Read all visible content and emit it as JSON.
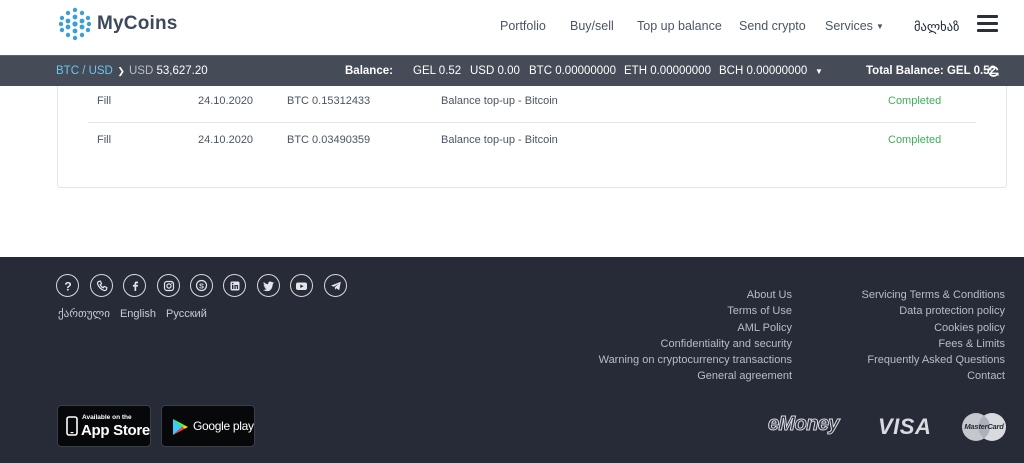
{
  "header": {
    "logo_text": "MyCoins",
    "nav": {
      "portfolio": "Portfolio",
      "buy_sell": "Buy/sell",
      "top_up": "Top up balance",
      "send_crypto": "Send crypto",
      "services": "Services"
    },
    "language_label": "მალხაზ"
  },
  "ticker": {
    "pair": "BTC / USD",
    "rate_currency": "USD",
    "rate_value": "53,627.20",
    "balance_label": "Balance:",
    "balances": [
      {
        "currency": "GEL",
        "value": "0.52"
      },
      {
        "currency": "USD",
        "value": "0.00"
      },
      {
        "currency": "BTC",
        "value": "0.00000000"
      },
      {
        "currency": "ETH",
        "value": "0.00000000"
      },
      {
        "currency": "BCH",
        "value": "0.00000000"
      }
    ],
    "total_label": "Total Balance:",
    "total_value": "GEL 0.52"
  },
  "transactions": [
    {
      "type": "Fill",
      "date": "24.10.2020",
      "amount": "BTC 0.15312433",
      "description": "Balance top-up - Bitcoin",
      "status": "Completed"
    },
    {
      "type": "Fill",
      "date": "24.10.2020",
      "amount": "BTC 0.03490359",
      "description": "Balance top-up - Bitcoin",
      "status": "Completed"
    }
  ],
  "footer": {
    "social_icons": [
      "help-icon",
      "phone-icon",
      "facebook-icon",
      "instagram-icon",
      "skype-icon",
      "linkedin-icon",
      "twitter-icon",
      "youtube-icon",
      "telegram-icon"
    ],
    "languages": [
      "ქართული",
      "English",
      "Русский"
    ],
    "links_left": [
      "About Us",
      "Terms of Use",
      "AML Policy",
      "Confidentiality and security",
      "Warning on cryptocurrency transactions",
      "General agreement"
    ],
    "links_right": [
      "Servicing Terms & Conditions",
      "Data protection policy",
      "Cookies policy",
      "Fees & Limits",
      "Frequently Asked Questions",
      "Contact"
    ],
    "app_store": {
      "small": "Available on the",
      "big": "App Store"
    },
    "google_play": {
      "big": "Google play"
    },
    "payment_logos": {
      "emoney": "eMoney",
      "visa": "VISA",
      "mastercard": "MasterCard"
    }
  },
  "colors": {
    "accent_blue": "#6cc4f0",
    "ticker_bg": "#454b57",
    "footer_bg": "#262b37",
    "completed_green": "#3fae5a"
  }
}
